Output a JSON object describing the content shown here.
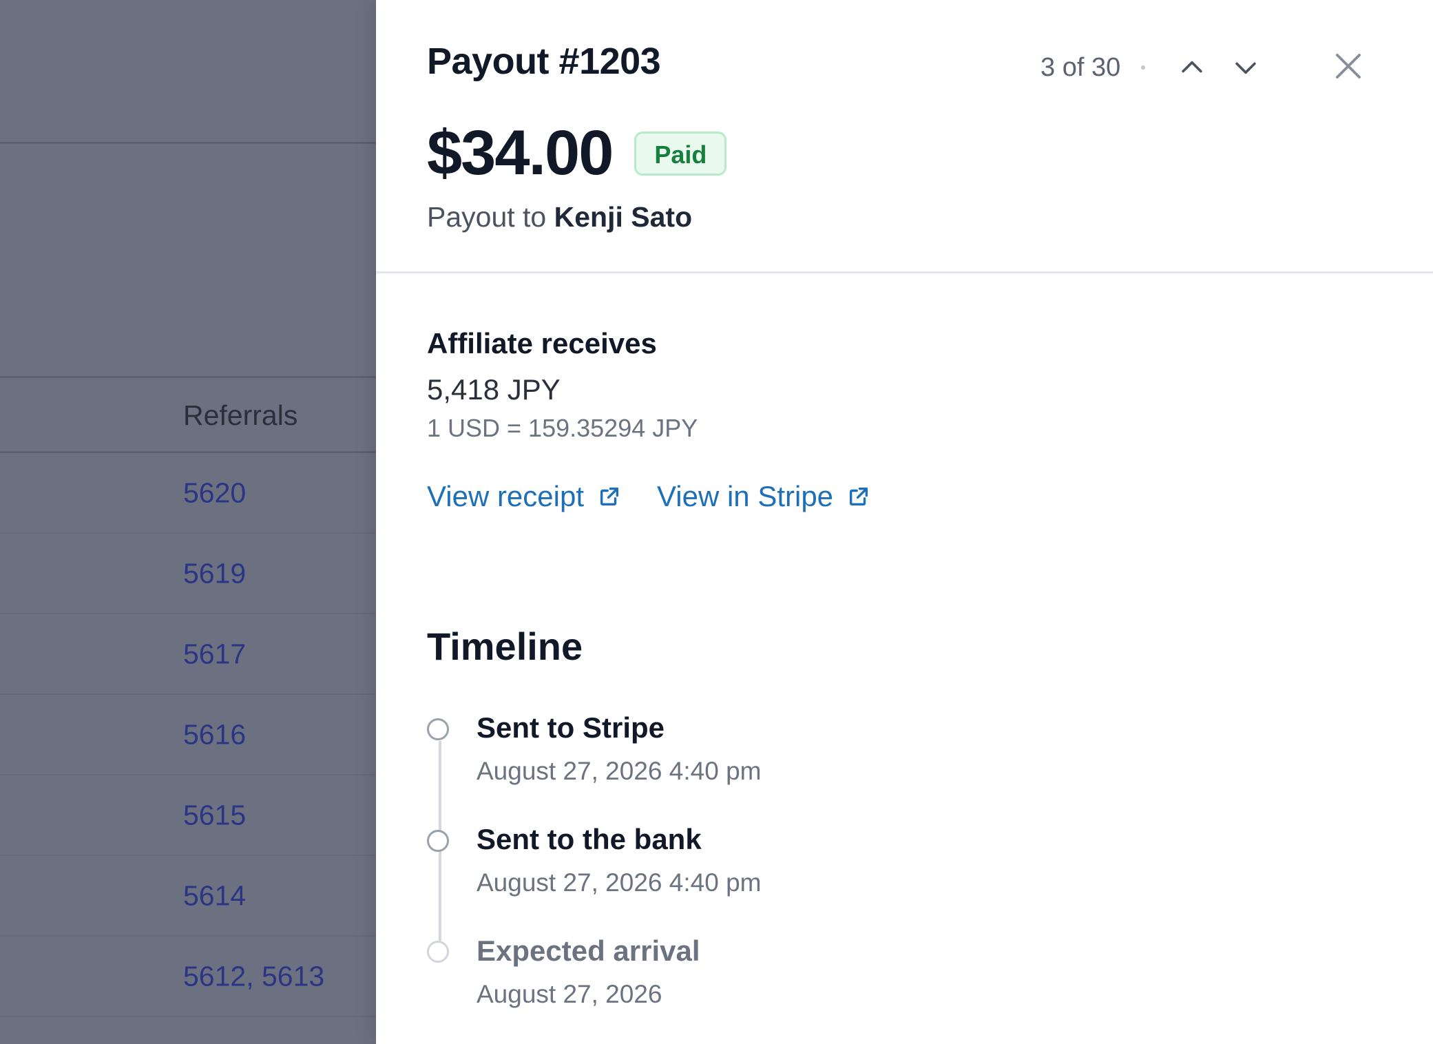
{
  "background": {
    "column_header": "Referrals",
    "rows": [
      "5620",
      "5619",
      "5617",
      "5616",
      "5615",
      "5614",
      "5612, 5613"
    ]
  },
  "panel": {
    "title": "Payout #1203",
    "pager": {
      "position_text": "3 of 30"
    },
    "amount": "$34.00",
    "status_badge": "Paid",
    "payout_to_prefix": "Payout to",
    "payout_to_name": "Kenji Sato",
    "affiliate": {
      "title": "Affiliate receives",
      "amount": "5,418 JPY",
      "rate": "1 USD = 159.35294 JPY"
    },
    "links": {
      "receipt": "View receipt",
      "stripe": "View in Stripe"
    },
    "timeline": {
      "title": "Timeline",
      "events": [
        {
          "title": "Sent to Stripe",
          "date": "August 27, 2026 4:40 pm"
        },
        {
          "title": "Sent to the bank",
          "date": "August 27, 2026 4:40 pm"
        },
        {
          "title": "Expected arrival",
          "date": "August 27, 2026"
        }
      ]
    }
  },
  "colors": {
    "overlay": "#6b7180",
    "link": "#1d6fb8",
    "badge_text": "#17803d",
    "badge_bg": "#ebfaef",
    "badge_border": "#b8ecc8",
    "background_link": "#2b3584"
  },
  "icons": {
    "previous": "chevron-up-icon",
    "next": "chevron-down-icon",
    "close": "close-icon",
    "external": "external-link-icon"
  }
}
